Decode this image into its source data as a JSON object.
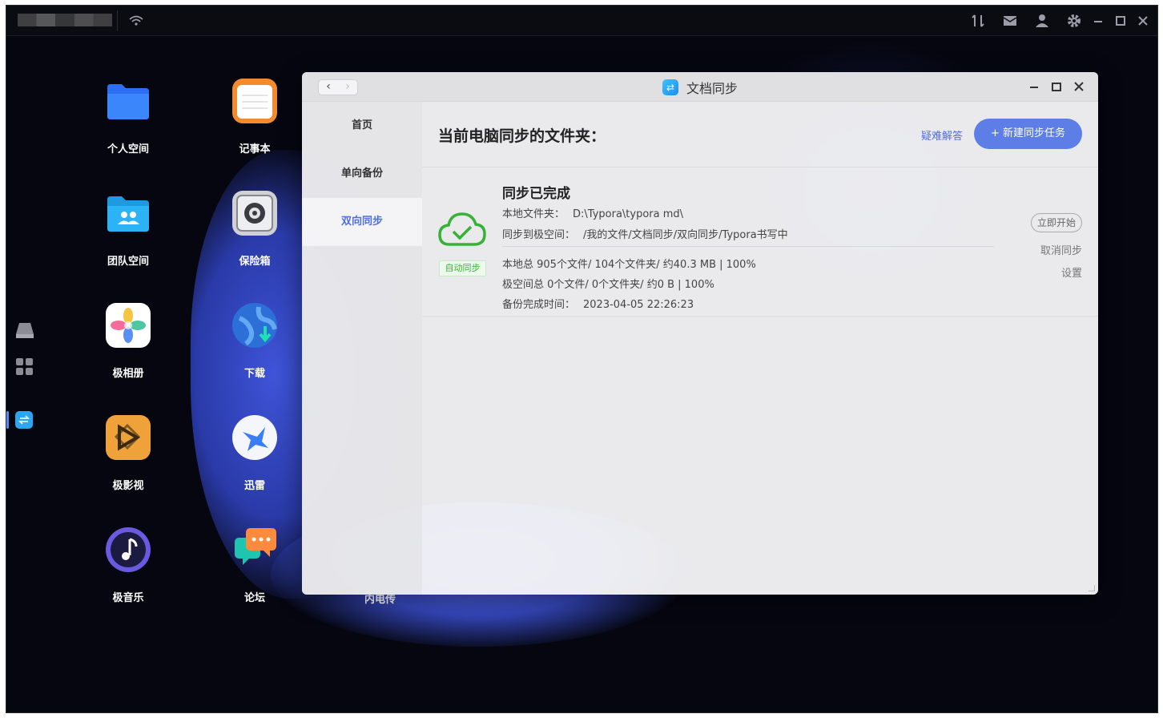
{
  "desktop": {
    "icons": [
      {
        "label": "个人空间",
        "icon": "folder-icon"
      },
      {
        "label": "记事本",
        "icon": "notepad-icon"
      },
      {
        "label": "团队空间",
        "icon": "team-folder-icon"
      },
      {
        "label": "保险箱",
        "icon": "safe-icon"
      },
      {
        "label": "极相册",
        "icon": "photos-icon"
      },
      {
        "label": "下载",
        "icon": "download-globe-icon"
      },
      {
        "label": "极影视",
        "icon": "video-icon"
      },
      {
        "label": "迅雷",
        "icon": "thunder-bird-icon"
      },
      {
        "label": "极音乐",
        "icon": "music-icon"
      },
      {
        "label": "论坛",
        "icon": "chat-bubbles-icon"
      }
    ],
    "partial_label": "内电传"
  },
  "window": {
    "title": "文档同步",
    "sidebar": [
      {
        "label": "首页",
        "active": false
      },
      {
        "label": "单向备份",
        "active": false
      },
      {
        "label": "双向同步",
        "active": true
      }
    ],
    "header": {
      "title": "当前电脑同步的文件夹：",
      "help_link": "疑难解答",
      "new_task_button": "+ 新建同步任务"
    },
    "task": {
      "status": "同步已完成",
      "auto_badge": "自动同步",
      "local_folder_label": "本地文件夹：",
      "local_folder_value": "D:\\Typora\\typora md\\",
      "remote_label": "同步到极空间：",
      "remote_value": "/我的文件/文档同步/双向同步/Typora书写中",
      "local_summary": "本地总 905个文件/ 104个文件夹/ 约40.3 MB | 100%",
      "remote_summary": "极空间总 0个文件/ 0个文件夹/ 约0 B | 100%",
      "backup_time_label": "备份完成时间：",
      "backup_time_value": "2023-04-05 22:26:23",
      "actions": {
        "start": "立即开始",
        "cancel": "取消同步",
        "settings": "设置"
      }
    }
  },
  "colors": {
    "accent": "#5c7ee6",
    "success": "#36b336",
    "desktop_bg": "#05060f"
  }
}
